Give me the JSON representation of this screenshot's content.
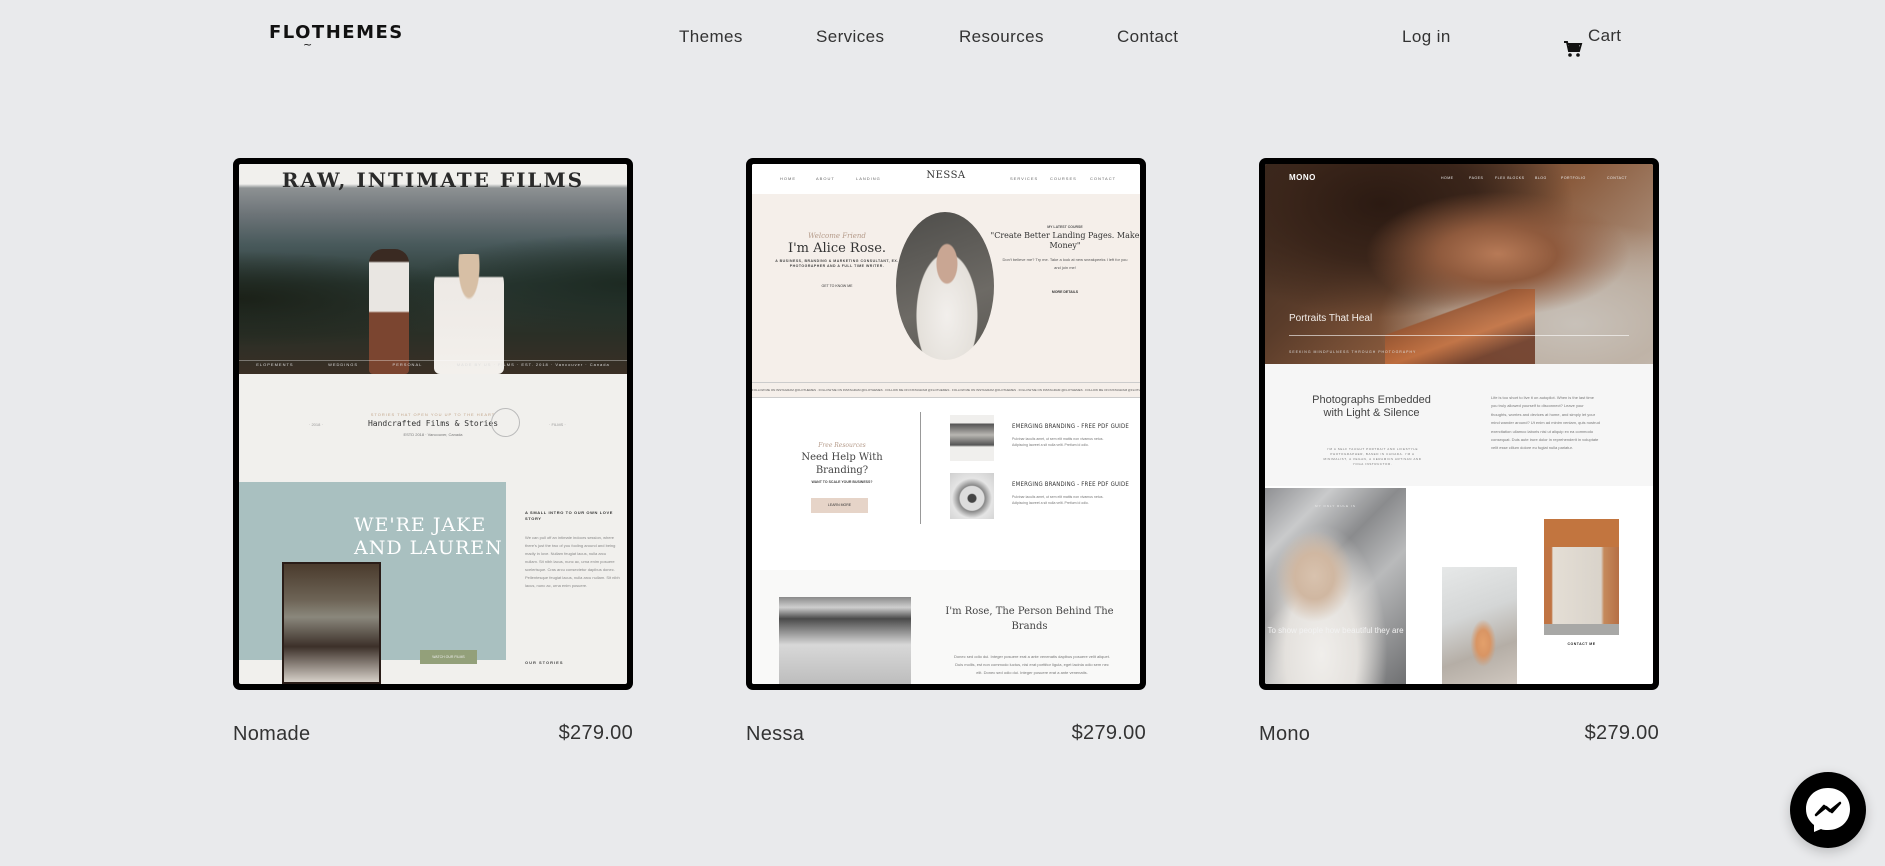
{
  "header": {
    "logo": "FLOTHEMES",
    "nav": [
      "Themes",
      "Services",
      "Resources",
      "Contact"
    ],
    "login_label": "Log in",
    "cart_label": "Cart",
    "cart_icon": "shopping-cart-icon"
  },
  "themes": [
    {
      "name": "Nomade",
      "price": "$279.00",
      "preview": {
        "hero_title": "RAW, INTIMATE FILMS",
        "hero_nav": [
          "ELOPEMENTS",
          "WEDDINGS",
          "PERSONAL",
          "MADE BY US · FILMS · EST. 2018 · Vancouver · Canada"
        ],
        "kicker": "STORIES THAT OPEN YOU UP TO THE HEART",
        "subtitle": "Handcrafted Films & Stories",
        "meta": "ESTD 2018 · Vancouver, Canada",
        "side_left": "· 2018 ·",
        "side_right": "· FILMS ·",
        "feature_title": "WE'RE JAKE AND LAUREN",
        "cta": "WATCH OUR FILMS",
        "copy_heading": "A SMALL INTRO TO OUR OWN LOVE STORY",
        "copy_body": "We can pull off an intimate indoors session, where there's just the two of you fooling around and being madly in love. Nullam feugiat lacus, nulla arcu nullam. Sit nibh lacus, nunc ac, urna enim posuere scelerisque. Cras arcu consectetur dapibus donec. Pellentesque feugiat lacus, nulla arcu nullam. Sit nibh lacus, nunc ac, urna enim posuere.",
        "copy_footer": "OUR STORIES"
      }
    },
    {
      "name": "Nessa",
      "price": "$279.00",
      "preview": {
        "brand": "NESSA",
        "nav_left": [
          "HOME",
          "ABOUT",
          "LANDING"
        ],
        "nav_right": [
          "SERVICES",
          "COURSES",
          "CONTACT"
        ],
        "script_greeting": "Welcome Friend",
        "hero_name": "I'm Alice Rose.",
        "hero_desc": "A BUSINESS, BRANDING & MARKETING CONSULTANT, EX. PHOTOGRAPHER AND A FULL TIME WRITER.",
        "hero_link": "GET TO KNOW ME",
        "right_kicker": "MY LATEST COURSE",
        "right_quote": "\"Create Better Landing Pages. Make Money\"",
        "right_body": "Don't believe me? Try me. Take a look at new sneakpeeks I left for you and join me!",
        "right_link": "MORE DETAILS",
        "ticker": "FOLLOW ME ON INSTAGRAM @FLOTHEMES · FOLLOW ME ON INSTAGRAM @FLOTHEMES · FOLLOW ME ON INSTAGRAM @FLOTHEMES · FOLLOW ME ON INSTAGRAM @FLOTHEMES · FOLLOW ME ON INSTAGRAM @FLOTHEMES · FOLLOW ME ON INSTAGRAM @FLOTHEMES",
        "free_script": "Free Resources",
        "need_help": "Need Help With Branding?",
        "want_scale": "WANT TO SCALE YOUR BUSINESS?",
        "learn_more": "LEARN MORE",
        "guides": [
          {
            "title": "EMERGING BRANDING - FREE PDF GUIDE",
            "body": "Pulvinar iaculis amet, ut sem elit mattis non vivamus netus. Adipiscing laoreet a sit nulla velit. Pretium id odio."
          },
          {
            "title": "EMERGING BRANDING - FREE PDF GUIDE",
            "body": "Pulvinar iaculis amet, ut sem elit mattis non vivamus netus. Adipiscing laoreet a sit nulla velit. Pretium id odio."
          }
        ],
        "about_title": "I'm Rose, The Person Behind The Brands",
        "about_body": "Donec sed odio dui. Integer posuere erat a ante venenatis dapibus posuere velit aliquet. Duis mollis, est non commodo luctus, nisi erat porttitor ligula, eget lacinia odio sem nec elit. Donec sed odio dui. Integer posuere erat a ante venenatis."
      }
    },
    {
      "name": "Mono",
      "price": "$279.00",
      "preview": {
        "brand": "MONO",
        "nav": [
          "HOME",
          "PAGES",
          "FLEX BLOCKS",
          "BLOG",
          "PORTFOLIO",
          "CONTACT"
        ],
        "hero_title": "Portraits That Heal",
        "hero_sub": "SEEKING MINDFULNESS THROUGH PHOTOGRAPHY",
        "section_title": "Photographs Embedded with Light & Silence",
        "section_sub": "I'M A SELF TAUGHT PORTRAIT AND LIFESTYLE PHOTOGRAPHER, BASED IN CANADA. I'M A MINIMALIST, A VEGAN, A CERAMICS ARTISAN AND YOGA INSTRUCTOR.",
        "section_body": "Life is too short to live it on autopilot. When is the last time you truly allowed yourself to disconnect? Leave your thoughts, worries and devices at home, and simply let your mind wander around? Ut enim ad minim veniam, quis nostrud exercitation ullamco laboris nisi ut aliquip ex ea commodo consequat. Duis aute irure dolor in reprehenderit in voluptate velit esse cillum dolore eu fugiat nulla pariatur.",
        "photo_kicker": "MY ONLY RULE IS",
        "photo_text": "To show people how beautiful they are",
        "contact_link": "CONTACT ME"
      }
    }
  ],
  "chat": {
    "icon": "messenger-icon"
  }
}
